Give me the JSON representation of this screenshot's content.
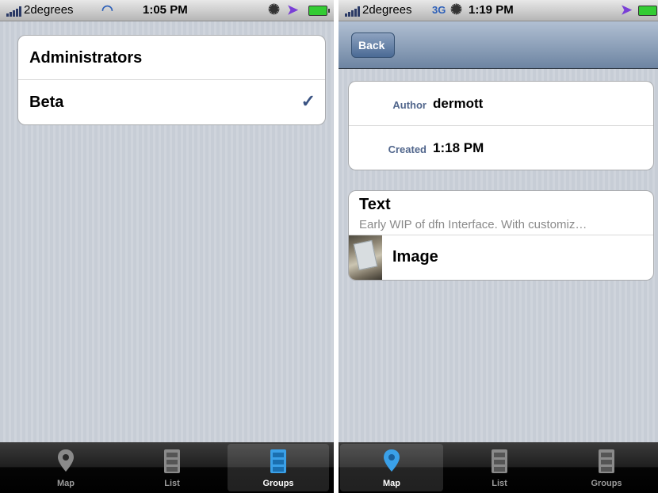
{
  "left": {
    "status": {
      "carrier": "2degrees",
      "time": "1:05 PM"
    },
    "groups": [
      {
        "label": "Administrators",
        "checked": false
      },
      {
        "label": "Beta",
        "checked": true
      }
    ],
    "check_glyph": "✓",
    "tabs": [
      {
        "label": "Map",
        "icon": "map-pin-icon"
      },
      {
        "label": "List",
        "icon": "cabinet-icon"
      },
      {
        "label": "Groups",
        "icon": "cabinet-icon"
      }
    ],
    "active_tab": "Groups"
  },
  "right": {
    "status": {
      "carrier": "2degrees",
      "network": "3G",
      "time": "1:19 PM"
    },
    "nav": {
      "back_label": "Back"
    },
    "details": [
      {
        "key": "Author",
        "value": "dermott"
      },
      {
        "key": "Created",
        "value": "1:18 PM"
      }
    ],
    "content": {
      "text_title": "Text",
      "text_preview": "Early WIP of dfn Interface. With customiz…",
      "image_label": "Image"
    },
    "tabs": [
      {
        "label": "Map",
        "icon": "map-pin-icon"
      },
      {
        "label": "List",
        "icon": "cabinet-icon"
      },
      {
        "label": "Groups",
        "icon": "cabinet-icon"
      }
    ],
    "active_tab": "Map"
  },
  "colors": {
    "accent": "#395282",
    "active_icon": "#3aa0e8"
  }
}
